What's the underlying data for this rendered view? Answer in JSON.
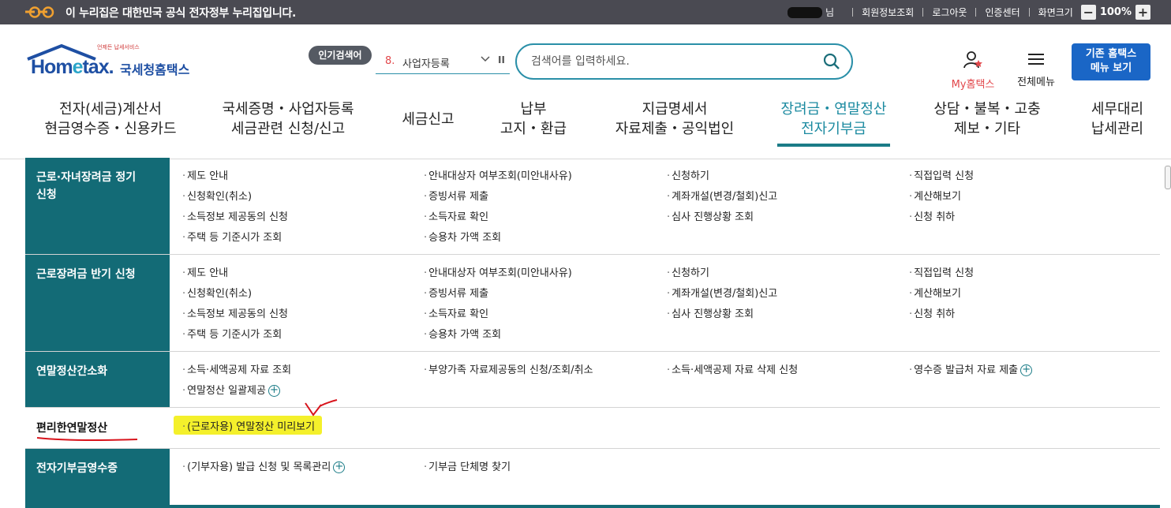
{
  "gov_banner": {
    "text": "이 누리집은 대한민국 공식 전자정부 누리집입니다."
  },
  "util": {
    "user_name_tail": "님",
    "links": [
      "회원정보조회",
      "로그아웃",
      "인증센터",
      "화면크기"
    ],
    "zoom_minus": "−",
    "zoom_value": "100%",
    "zoom_plus": "+"
  },
  "logo": {
    "sub": "언제든 납세서비스",
    "main_a": "Hom",
    "main_b": "e",
    "main_c": "tax.",
    "kr": "국세청홈택스"
  },
  "popular": {
    "badge": "인기검색어",
    "rank": "8.",
    "keyword": "사업자등록",
    "pause": "II"
  },
  "search": {
    "placeholder": "검색어를 입력하세요."
  },
  "my_hometax": {
    "label": "My홈택스"
  },
  "all_menu": {
    "label": "전체메뉴"
  },
  "classic_button": {
    "line1": "기존 홈택스",
    "line2": "메뉴 보기"
  },
  "gnb": [
    {
      "line1": "전자(세금)계산서",
      "line2": "현금영수증・신용카드"
    },
    {
      "line1": "국세증명・사업자등록",
      "line2": "세금관련 신청/신고"
    },
    {
      "line1": "세금신고",
      "line2": ""
    },
    {
      "line1": "납부",
      "line2": "고지・환급"
    },
    {
      "line1": "지급명세서",
      "line2": "자료제출・공익법인"
    },
    {
      "line1": "장려금・연말정산",
      "line2": "전자기부금",
      "active": true
    },
    {
      "line1": "상담・불복・고충",
      "line2": "제보・기타"
    },
    {
      "line1": "세무대리",
      "line2": "납세관리"
    }
  ],
  "sections": [
    {
      "title_line1": "근로·자녀장려금 정기",
      "title_line2": "신청",
      "links": [
        "제도 안내",
        "안내대상자 여부조회(미안내사유)",
        "신청하기",
        "직접입력 신청",
        "신청확인(취소)",
        "증빙서류 제출",
        "계좌개설(변경/철회)신고",
        "계산해보기",
        "소득정보 제공동의 신청",
        "소득자료 확인",
        "심사 진행상황 조회",
        "신청 취하",
        "주택 등 기준시가 조회",
        "승용차 가액 조회"
      ]
    },
    {
      "title_line1": "근로장려금 반기 신청",
      "title_line2": "",
      "links": [
        "제도 안내",
        "안내대상자 여부조회(미안내사유)",
        "신청하기",
        "직접입력 신청",
        "신청확인(취소)",
        "증빙서류 제출",
        "계좌개설(변경/철회)신고",
        "계산해보기",
        "소득정보 제공동의 신청",
        "소득자료 확인",
        "심사 진행상황 조회",
        "신청 취하",
        "주택 등 기준시가 조회",
        "승용차 가액 조회"
      ]
    },
    {
      "title_line1": "연말정산간소화",
      "title_line2": "",
      "links": [
        "소득·세액공제 자료 조회",
        "부양가족 자료제공동의 신청/조회/취소",
        "소득·세액공제 자료 삭제 신청",
        "영수증 발급처 자료 제출",
        "연말정산 일괄제공"
      ]
    },
    {
      "title_line1": "편리한연말정산",
      "title_line2": "",
      "links": [
        "(근로자용) 연말정산 미리보기"
      ]
    },
    {
      "title_line1": "전자기부금영수증",
      "title_line2": "",
      "links": [
        "(기부자용) 발급 신청 및 목록관리",
        "기부금 단체명 찾기"
      ]
    }
  ],
  "link_bullet": "·",
  "plus_glyph": "+",
  "colors": {
    "teal_side": "#136b76",
    "accent": "#1b8aa0",
    "highlight": "#f4f02b",
    "annotation": "#d8141c"
  }
}
